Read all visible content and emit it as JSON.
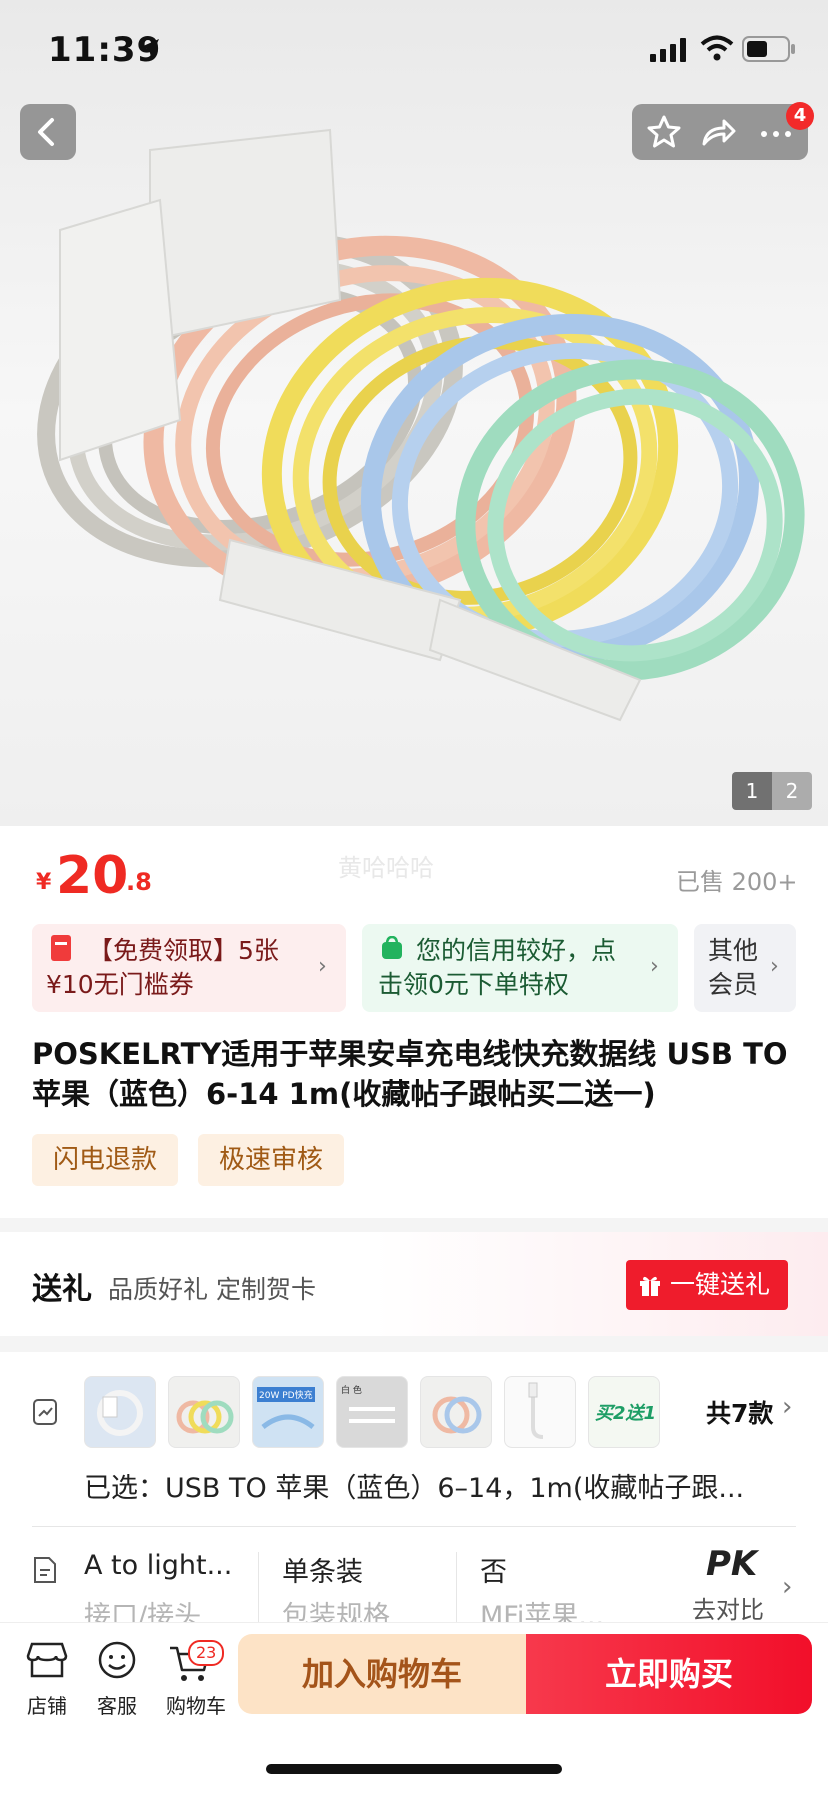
{
  "status_bar": {
    "time": "11:39"
  },
  "header": {
    "notification_count": "4"
  },
  "gallery": {
    "pages": [
      "1",
      "2"
    ],
    "current_page": 1
  },
  "price": {
    "currency": "¥",
    "integer": "20",
    "decimal": ".8",
    "sold": "已售 200+",
    "watermark": "黄哈哈哈"
  },
  "coupons": [
    {
      "line1": "【免费领取】5张",
      "line2": "¥10无门槛券"
    },
    {
      "line1": "您的信用较好，点",
      "line2": "击领0元下单特权"
    },
    {
      "line1": "其他",
      "line2": "会员"
    }
  ],
  "product": {
    "title": "POSKELRTY适用于苹果安卓充电线快充数据线 USB TO 苹果（蓝色）6-14 1m(收藏帖子跟帖买二送一)",
    "tags": [
      "闪电退款",
      "极速审核"
    ]
  },
  "gift": {
    "title": "送礼",
    "subtitle": "品质好礼 定制贺卡",
    "button": "一键送礼"
  },
  "variants": {
    "thumbnail_labels": [
      "20W PD快充",
      "白 色",
      "买2送1"
    ],
    "count_label": "共7款",
    "selected": "已选：USB TO 苹果（蓝色）6–14，1m(收藏帖子跟..."
  },
  "specs": [
    {
      "value": "A to light...",
      "key": "接口/接头"
    },
    {
      "value": "单条装",
      "key": "包装规格"
    },
    {
      "value": "否",
      "key": "MFi苹果..."
    }
  ],
  "compare": {
    "title": "PK",
    "label": "去对比"
  },
  "bottom_nav": {
    "store": "店铺",
    "service": "客服",
    "cart": "购物车",
    "cart_count": "23",
    "add_to_cart": "加入购物车",
    "buy_now": "立即购买"
  }
}
